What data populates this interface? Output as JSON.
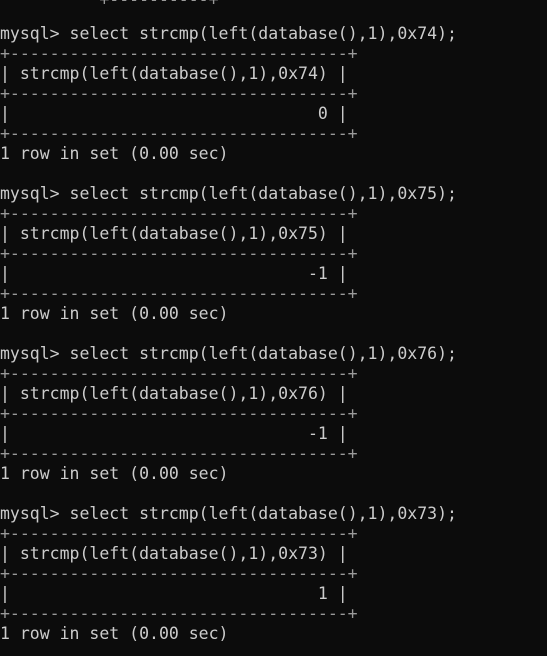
{
  "terminal": {
    "top_fragment": "          +----------+",
    "blocks": [
      {
        "prompt": "mysql>",
        "command": " select strcmp(left(database(),1),0x74);",
        "border": "+----------------------------------+",
        "header": "| strcmp(left(database(),1),0x74) |",
        "value_row": "|                               0 |",
        "footer": "1 row in set (0.00 sec)"
      },
      {
        "prompt": "mysql>",
        "command": " select strcmp(left(database(),1),0x75);",
        "border": "+----------------------------------+",
        "header": "| strcmp(left(database(),1),0x75) |",
        "value_row": "|                              -1 |",
        "footer": "1 row in set (0.00 sec)"
      },
      {
        "prompt": "mysql>",
        "command": " select strcmp(left(database(),1),0x76);",
        "border": "+----------------------------------+",
        "header": "| strcmp(left(database(),1),0x76) |",
        "value_row": "|                              -1 |",
        "footer": "1 row in set (0.00 sec)"
      },
      {
        "prompt": "mysql>",
        "command": " select strcmp(left(database(),1),0x73);",
        "border": "+----------------------------------+",
        "header": "| strcmp(left(database(),1),0x73) |",
        "value_row": "|                               1 |",
        "footer": "1 row in set (0.00 sec)"
      }
    ]
  }
}
